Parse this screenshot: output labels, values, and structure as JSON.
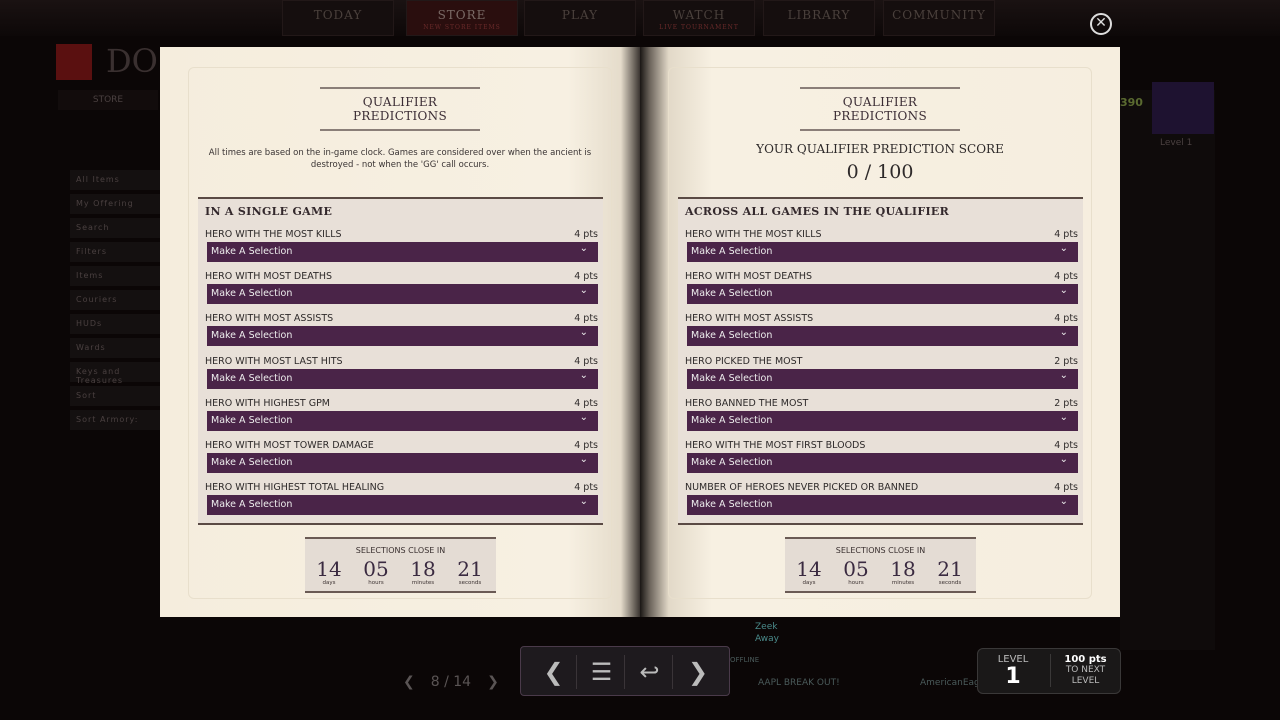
{
  "nav": {
    "tabs": [
      {
        "label": "TODAY",
        "sub": ""
      },
      {
        "label": "STORE",
        "sub": "NEW STORE ITEMS"
      },
      {
        "label": "PLAY",
        "sub": ""
      },
      {
        "label": "WATCH",
        "sub": "LIVE TOURNAMENT"
      },
      {
        "label": "LIBRARY",
        "sub": ""
      },
      {
        "label": "COMMUNITY",
        "sub": ""
      }
    ]
  },
  "background": {
    "logo_text": "DO",
    "store": "STORE",
    "sidebar": [
      "All Items",
      "My Offering",
      "Search",
      "",
      "Filters",
      "Items",
      "Couriers",
      "HUDs",
      "Wards",
      "Keys and Treasures",
      "Sort",
      "Sort Armory:"
    ],
    "gold": "390",
    "level": "Level 1",
    "friends": [
      "Zeek",
      "Away",
      "OFFLINE",
      "AAPL BREAK OUT!",
      "AmericanEagle"
    ]
  },
  "left": {
    "title": "QUALIFIER PREDICTIONS",
    "note": "All times are based on the in-game clock. Games are considered over when the ancient is destroyed - not when the 'GG' call occurs.",
    "section_title": "IN A SINGLE GAME",
    "rows": [
      {
        "label": "HERO WITH THE MOST KILLS",
        "pts": "4 pts",
        "value": "Make A Selection"
      },
      {
        "label": "HERO WITH MOST DEATHS",
        "pts": "4 pts",
        "value": "Make A Selection"
      },
      {
        "label": "HERO WITH MOST ASSISTS",
        "pts": "4 pts",
        "value": "Make A Selection"
      },
      {
        "label": "HERO WITH MOST LAST HITS",
        "pts": "4 pts",
        "value": "Make A Selection"
      },
      {
        "label": "HERO WITH HIGHEST GPM",
        "pts": "4 pts",
        "value": "Make A Selection"
      },
      {
        "label": "HERO WITH MOST TOWER DAMAGE",
        "pts": "4 pts",
        "value": "Make A Selection"
      },
      {
        "label": "HERO WITH HIGHEST TOTAL HEALING",
        "pts": "4 pts",
        "value": "Make A Selection"
      }
    ]
  },
  "right": {
    "title": "QUALIFIER PREDICTIONS",
    "score_label": "YOUR QUALIFIER PREDICTION SCORE",
    "score": "0 / 100",
    "section_title": "ACROSS ALL GAMES IN THE QUALIFIER",
    "rows": [
      {
        "label": "HERO WITH THE MOST KILLS",
        "pts": "4 pts",
        "value": "Make A Selection"
      },
      {
        "label": "HERO WITH MOST DEATHS",
        "pts": "4 pts",
        "value": "Make A Selection"
      },
      {
        "label": "HERO WITH MOST ASSISTS",
        "pts": "4 pts",
        "value": "Make A Selection"
      },
      {
        "label": "HERO PICKED THE MOST",
        "pts": "2 pts",
        "value": "Make A Selection"
      },
      {
        "label": "HERO BANNED THE MOST",
        "pts": "2 pts",
        "value": "Make A Selection"
      },
      {
        "label": "HERO WITH THE MOST FIRST BLOODS",
        "pts": "4 pts",
        "value": "Make A Selection"
      },
      {
        "label": "NUMBER OF HEROES NEVER PICKED OR BANNED",
        "pts": "4 pts",
        "value": "Make A Selection"
      }
    ]
  },
  "timer": {
    "heading": "SELECTIONS CLOSE IN",
    "units": [
      {
        "value": "14",
        "unit": "days"
      },
      {
        "value": "05",
        "unit": "hours"
      },
      {
        "value": "18",
        "unit": "minutes"
      },
      {
        "value": "21",
        "unit": "seconds"
      }
    ]
  },
  "pager": {
    "text": "8 / 14"
  },
  "controls": {
    "prev": "❮",
    "list": "☰",
    "back": "↩",
    "next": "❯"
  },
  "level": {
    "label": "LEVEL",
    "value": "1",
    "pts": "100 pts",
    "to_next": "TO NEXT LEVEL"
  },
  "colors": {
    "dropdown": "#4a2448",
    "page": "#f7f0e1"
  }
}
